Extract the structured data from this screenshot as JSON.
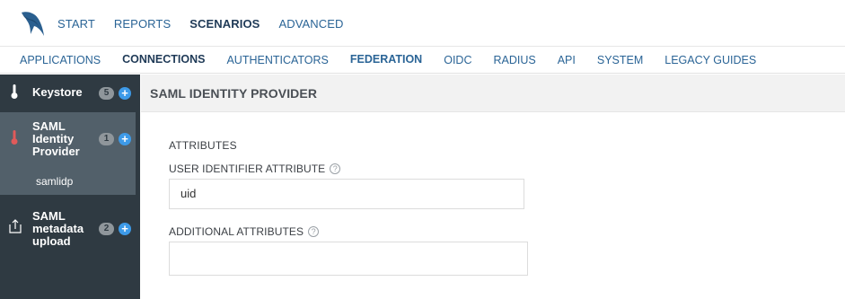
{
  "top_nav": {
    "items": [
      {
        "label": "START",
        "active": false
      },
      {
        "label": "REPORTS",
        "active": false
      },
      {
        "label": "SCENARIOS",
        "active": true
      },
      {
        "label": "ADVANCED",
        "active": false
      }
    ]
  },
  "sub_nav": {
    "items": [
      {
        "label": "APPLICATIONS"
      },
      {
        "label": "CONNECTIONS"
      },
      {
        "label": "AUTHENTICATORS"
      },
      {
        "label": "FEDERATION"
      },
      {
        "label": "OIDC"
      },
      {
        "label": "RADIUS"
      },
      {
        "label": "API"
      },
      {
        "label": "SYSTEM"
      },
      {
        "label": "LEGACY GUIDES"
      }
    ]
  },
  "sidebar": {
    "items": [
      {
        "label": "Keystore",
        "count": "5",
        "icon": "thermometer-icon"
      },
      {
        "label": "SAML Identity Provider",
        "count": "1",
        "icon": "thermometer-icon",
        "sub_items": [
          "samlidp"
        ]
      },
      {
        "label": "SAML metadata upload",
        "count": "2",
        "icon": "upload-icon"
      }
    ],
    "plus_glyph": "+"
  },
  "main": {
    "title": "SAML IDENTITY PROVIDER",
    "section_title": "ATTRIBUTES",
    "fields": [
      {
        "label": "USER IDENTIFIER ATTRIBUTE",
        "value": "uid",
        "help": "?"
      },
      {
        "label": "ADDITIONAL ATTRIBUTES",
        "value": "",
        "help": "?"
      }
    ]
  },
  "colors": {
    "link": "#2a6496",
    "active_nav": "#1f3a57",
    "sidebar_bg": "#2f3a42",
    "sidebar_active": "#52606a",
    "plus_button": "#3d9ae8",
    "alert_icon": "#e05a5a"
  }
}
